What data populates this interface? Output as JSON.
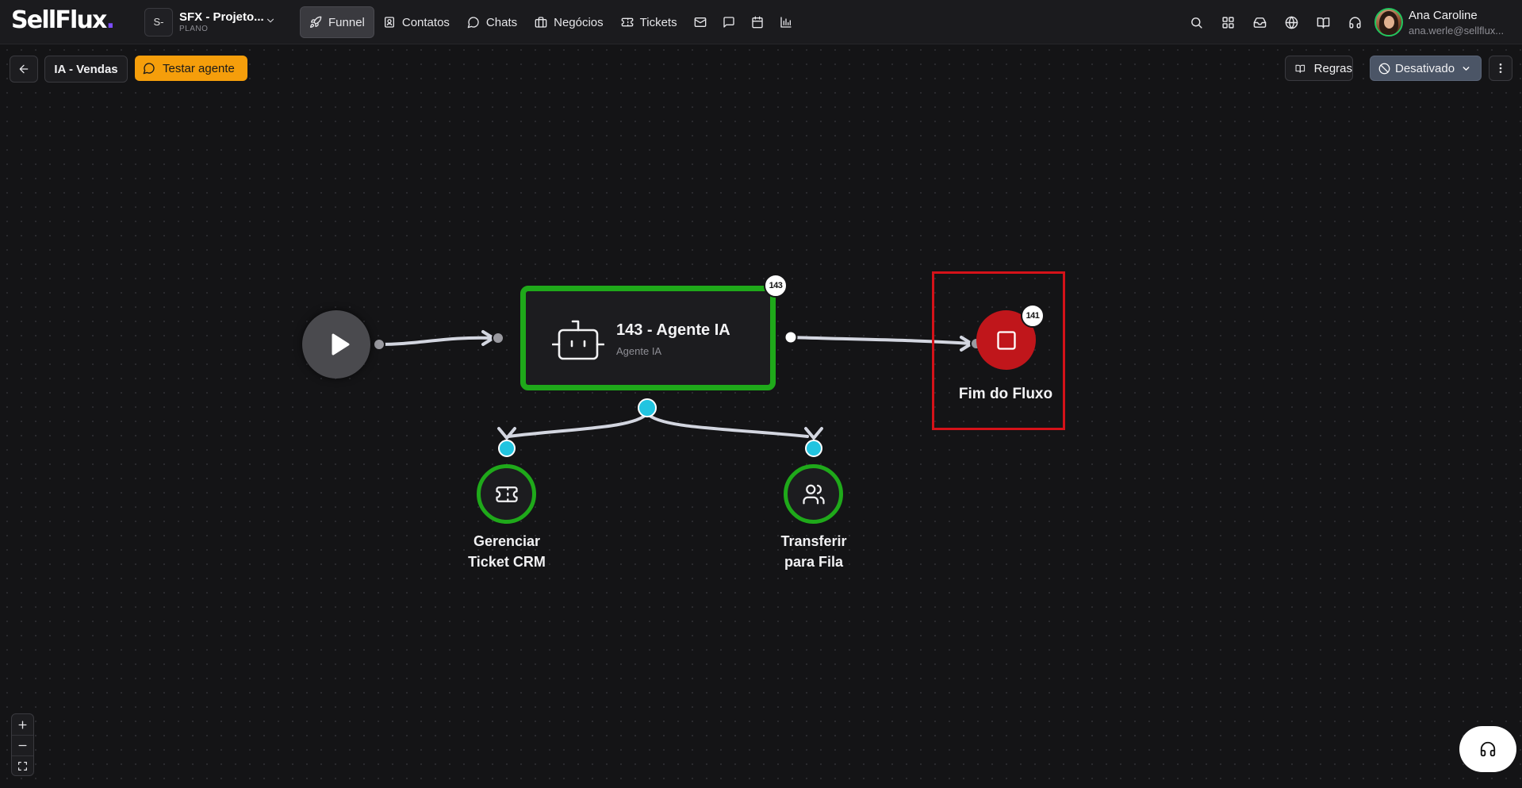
{
  "app": {
    "logo_text": "SellFlux",
    "logo_dot": ".",
    "brand_color": "#7c4dff"
  },
  "project": {
    "badge": "S-",
    "name": "SFX - Projeto...",
    "plan": "PLANO"
  },
  "nav": {
    "items": [
      {
        "label": "Funnel",
        "icon": "rocket-icon",
        "active": true
      },
      {
        "label": "Contatos",
        "icon": "contact-card-icon"
      },
      {
        "label": "Chats",
        "icon": "chat-bubble-icon"
      },
      {
        "label": "Negócios",
        "icon": "briefcase-icon"
      },
      {
        "label": "Tickets",
        "icon": "ticket-icon"
      }
    ],
    "icon_items": [
      "mail-icon",
      "message-square-icon",
      "calendar-icon",
      "bar-chart-icon"
    ]
  },
  "header_icons": [
    "search-icon",
    "apps-grid-icon",
    "inbox-icon",
    "globe-icon",
    "book-icon",
    "headset-icon"
  ],
  "user": {
    "name": "Ana Caroline",
    "email": "ana.werle@sellflux..."
  },
  "toolbar": {
    "flow_name": "IA - Vendas",
    "test_label": "Testar agente",
    "rules_label": "Regras",
    "status_label": "Desativado",
    "accent_color": "#f59e0b"
  },
  "flow": {
    "agent": {
      "title": "143 - Agente IA",
      "subtitle": "Agente IA",
      "badge": "143"
    },
    "end": {
      "label": "Fim do Fluxo",
      "badge": "141",
      "color": "#c0161b"
    },
    "tools": [
      {
        "line1": "Gerenciar",
        "line2": "Ticket CRM",
        "icon": "ticket-icon"
      },
      {
        "line1": "Transferir",
        "line2": "para Fila",
        "icon": "users-icon"
      }
    ],
    "node_border_color": "#1fa91a",
    "handle_color": "#22c4e0"
  },
  "zoom_controls": [
    "zoom-in-icon",
    "zoom-out-icon",
    "fit-view-icon"
  ]
}
